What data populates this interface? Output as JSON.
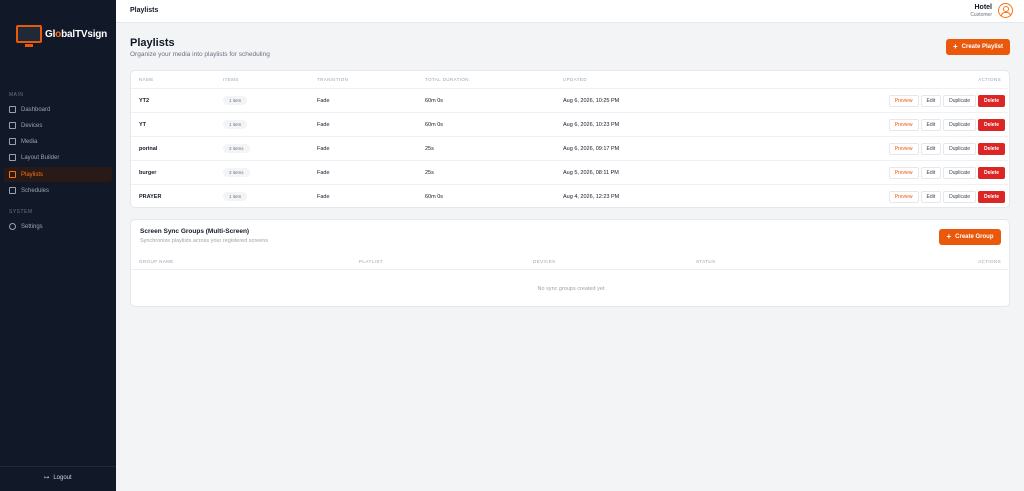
{
  "app": {
    "logo_prefix": "Gl",
    "logo_accent": "o",
    "logo_mid": "bal",
    "logo_suffix": "TVsign"
  },
  "sidebar": {
    "section_main": "MAIN",
    "section_system": "SYSTEM",
    "items": [
      {
        "label": "Dashboard",
        "icon": "dashboard-icon"
      },
      {
        "label": "Devices",
        "icon": "monitor-icon"
      },
      {
        "label": "Media",
        "icon": "image-icon"
      },
      {
        "label": "Layout Builder",
        "icon": "layout-icon"
      },
      {
        "label": "Playlists",
        "icon": "list-icon",
        "active": true
      },
      {
        "label": "Schedules",
        "icon": "calendar-icon"
      }
    ],
    "settings_label": "Settings",
    "logout_label": "Logout"
  },
  "header": {
    "title": "Playlists",
    "user_name": "Hotel",
    "user_role": "Customer"
  },
  "page": {
    "title": "Playlists",
    "subtitle": "Organize your media into playlists for scheduling",
    "create_label": "Create Playlist"
  },
  "playlists_table": {
    "columns": [
      "NAME",
      "ITEMS",
      "TRANSITION",
      "TOTAL DURATION",
      "UPDATED",
      "ACTIONS"
    ],
    "rows": [
      {
        "name": "YT2",
        "items": "1 item",
        "transition": "Fade",
        "duration": "60m 0s",
        "updated": "Aug 6, 2026, 10:25 PM"
      },
      {
        "name": "YT",
        "items": "1 item",
        "transition": "Fade",
        "duration": "60m 0s",
        "updated": "Aug 6, 2026, 10:23 PM"
      },
      {
        "name": "porinal",
        "items": "3 items",
        "transition": "Fade",
        "duration": "25s",
        "updated": "Aug 6, 2026, 09:17 PM"
      },
      {
        "name": "burger",
        "items": "3 items",
        "transition": "Fade",
        "duration": "25s",
        "updated": "Aug 5, 2026, 08:11 PM"
      },
      {
        "name": "PRAYER",
        "items": "1 item",
        "transition": "Fade",
        "duration": "60m 0s",
        "updated": "Aug 4, 2026, 12:23 PM"
      }
    ],
    "action_labels": {
      "preview": "Preview",
      "edit": "Edit",
      "duplicate": "Duplicate",
      "delete": "Delete"
    }
  },
  "sync_groups": {
    "title": "Screen Sync Groups (Multi-Screen)",
    "subtitle": "Synchronize playlists across your registered screens",
    "create_label": "Create Group",
    "columns": [
      "GROUP NAME",
      "PLAYLIST",
      "DEVICES",
      "STATUS",
      "ACTIONS"
    ],
    "empty_text": "No sync groups created yet"
  },
  "colors": {
    "accent": "#ea580c",
    "danger": "#dc2626",
    "sidebar_bg": "#111827"
  }
}
